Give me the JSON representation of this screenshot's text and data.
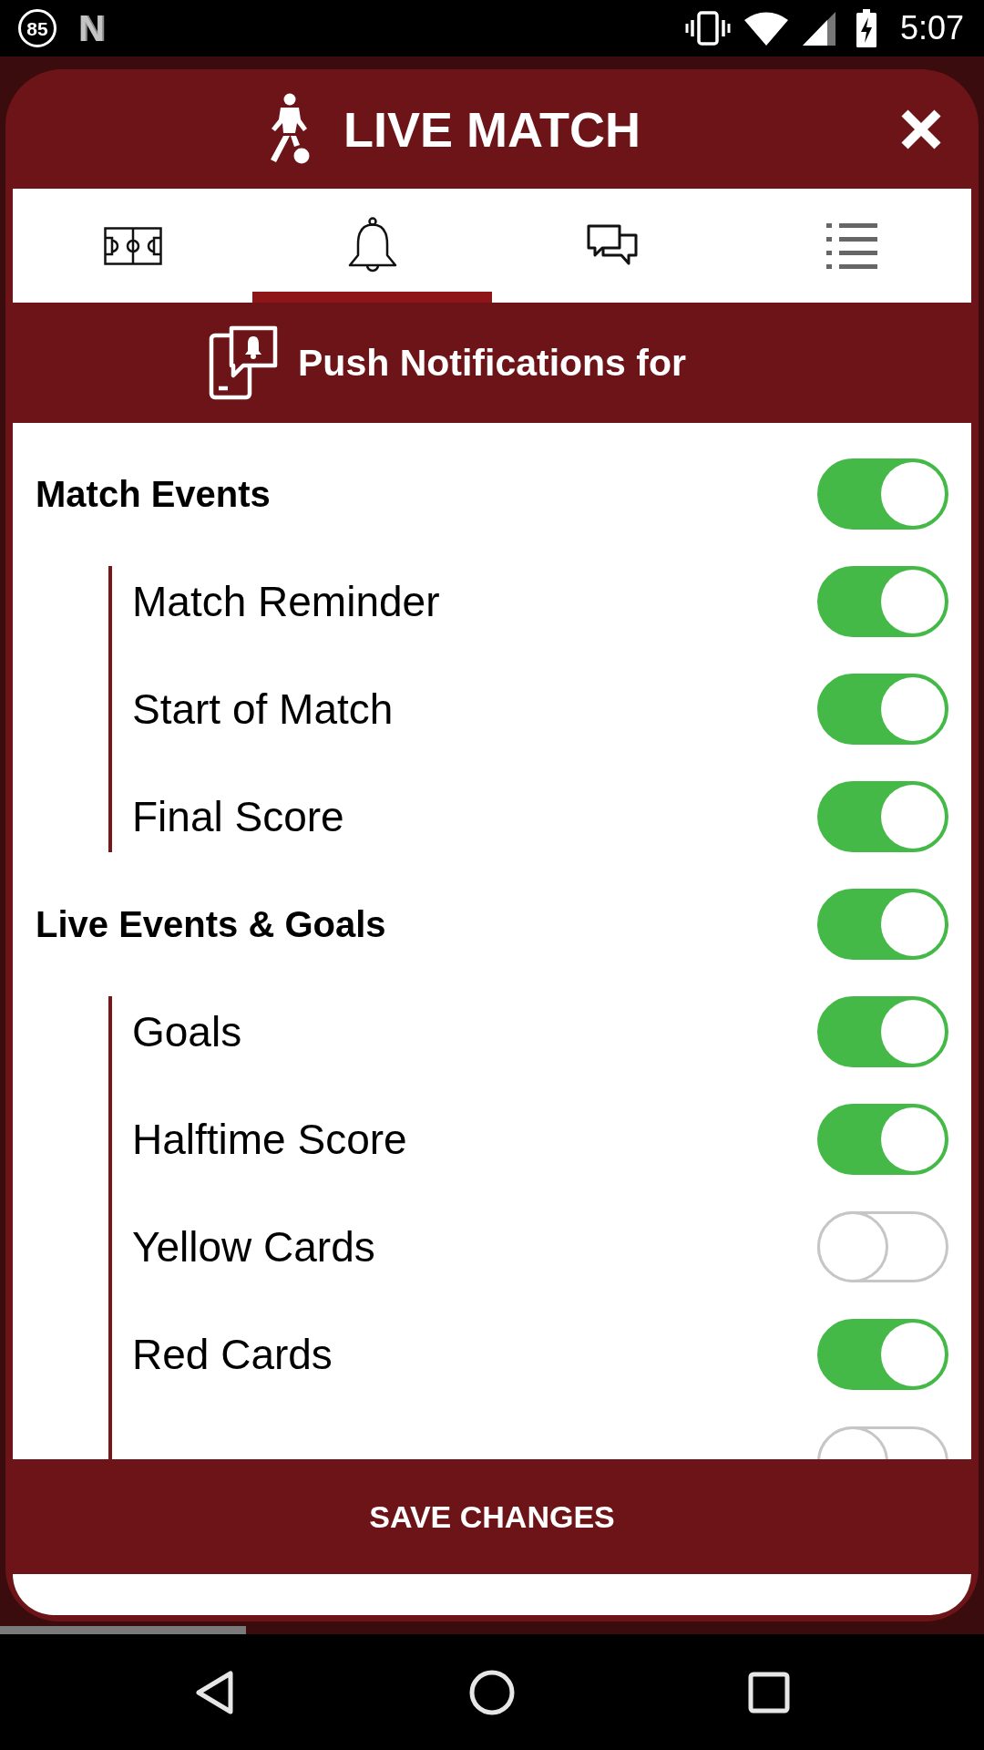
{
  "status_bar": {
    "badge": "85",
    "app_letter": "N",
    "time": "5:07"
  },
  "header": {
    "title": "LIVE MATCH"
  },
  "tabs": [
    {
      "selected": false
    },
    {
      "selected": true
    },
    {
      "selected": false
    },
    {
      "selected": false
    }
  ],
  "section": {
    "title": "Push Notifications for"
  },
  "groups": [
    {
      "label": "Match Events",
      "on": true,
      "children": [
        {
          "label": "Match Reminder",
          "on": true
        },
        {
          "label": "Start of Match",
          "on": true
        },
        {
          "label": "Final Score",
          "on": true
        }
      ]
    },
    {
      "label": "Live Events & Goals",
      "on": true,
      "children": [
        {
          "label": "Goals",
          "on": true
        },
        {
          "label": "Halftime Score",
          "on": true
        },
        {
          "label": "Yellow Cards",
          "on": false
        },
        {
          "label": "Red Cards",
          "on": true
        },
        {
          "on": false
        }
      ]
    }
  ],
  "save_button": {
    "label": "SAVE CHANGES"
  }
}
